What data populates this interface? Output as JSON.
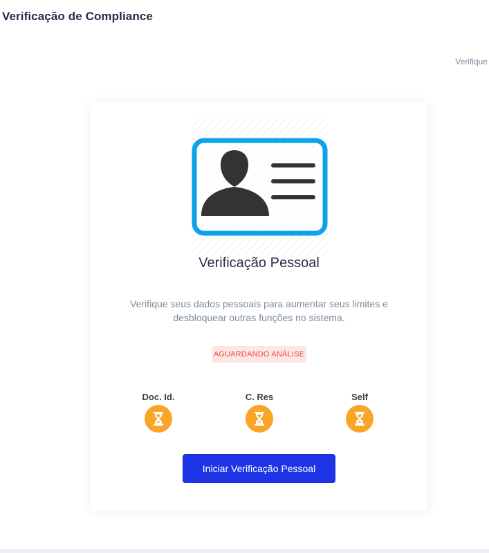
{
  "header": {
    "title": "Verificação de Compliance",
    "breadcrumb": "Verifique"
  },
  "card": {
    "title": "Verificação Pessoal",
    "description": "Verifique seus dados pessoais para aumentar seus limites e desbloquear outras funções no sistema.",
    "status": "AGUARDANDO ANÁLISE",
    "steps": [
      {
        "label": "Doc. Id.",
        "icon": "hourglass-icon",
        "status": "pending"
      },
      {
        "label": "C. Res",
        "icon": "hourglass-icon",
        "status": "pending"
      },
      {
        "label": "Self",
        "icon": "hourglass-icon",
        "status": "pending"
      }
    ],
    "button_label": "Iniciar Verificação Pessoal",
    "illustration_icon": "id-card-icon"
  },
  "colors": {
    "accent": "#1d35e6",
    "pending": "#f9a528",
    "status_text": "#f04a36",
    "status_bg": "#fde7e5",
    "card_border": "#0da2ea"
  }
}
